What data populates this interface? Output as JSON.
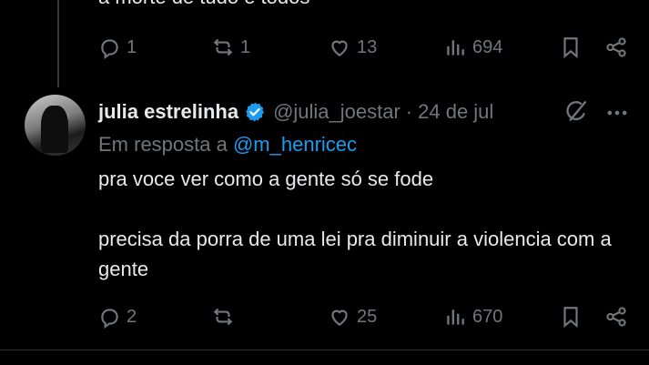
{
  "previous_tweet": {
    "partial_text": "a morte de tudo e todos",
    "actions": {
      "reply_count": "1",
      "retweet_count": "1",
      "like_count": "13",
      "view_count": "694"
    }
  },
  "tweet": {
    "display_name": "julia estrelinha",
    "handle": "@julia_joestar",
    "separator": "·",
    "date": "24 de jul",
    "reply_prefix": "Em resposta a",
    "reply_mention": "@m_henricec",
    "line1": "pra voce ver como a gente só se fode",
    "line2": "precisa da porra de uma lei pra diminuir a violencia com a gente",
    "actions": {
      "reply_count": "2",
      "retweet_count": "",
      "like_count": "25",
      "view_count": "670"
    }
  },
  "colors": {
    "background": "#000000",
    "text": "#e7e9ea",
    "muted": "#71767b",
    "accent": "#1d9bf0"
  },
  "icons": [
    "reply-icon",
    "retweet-icon",
    "like-icon",
    "views-icon",
    "bookmark-icon",
    "share-icon",
    "verified-icon",
    "grok-icon",
    "more-icon"
  ]
}
